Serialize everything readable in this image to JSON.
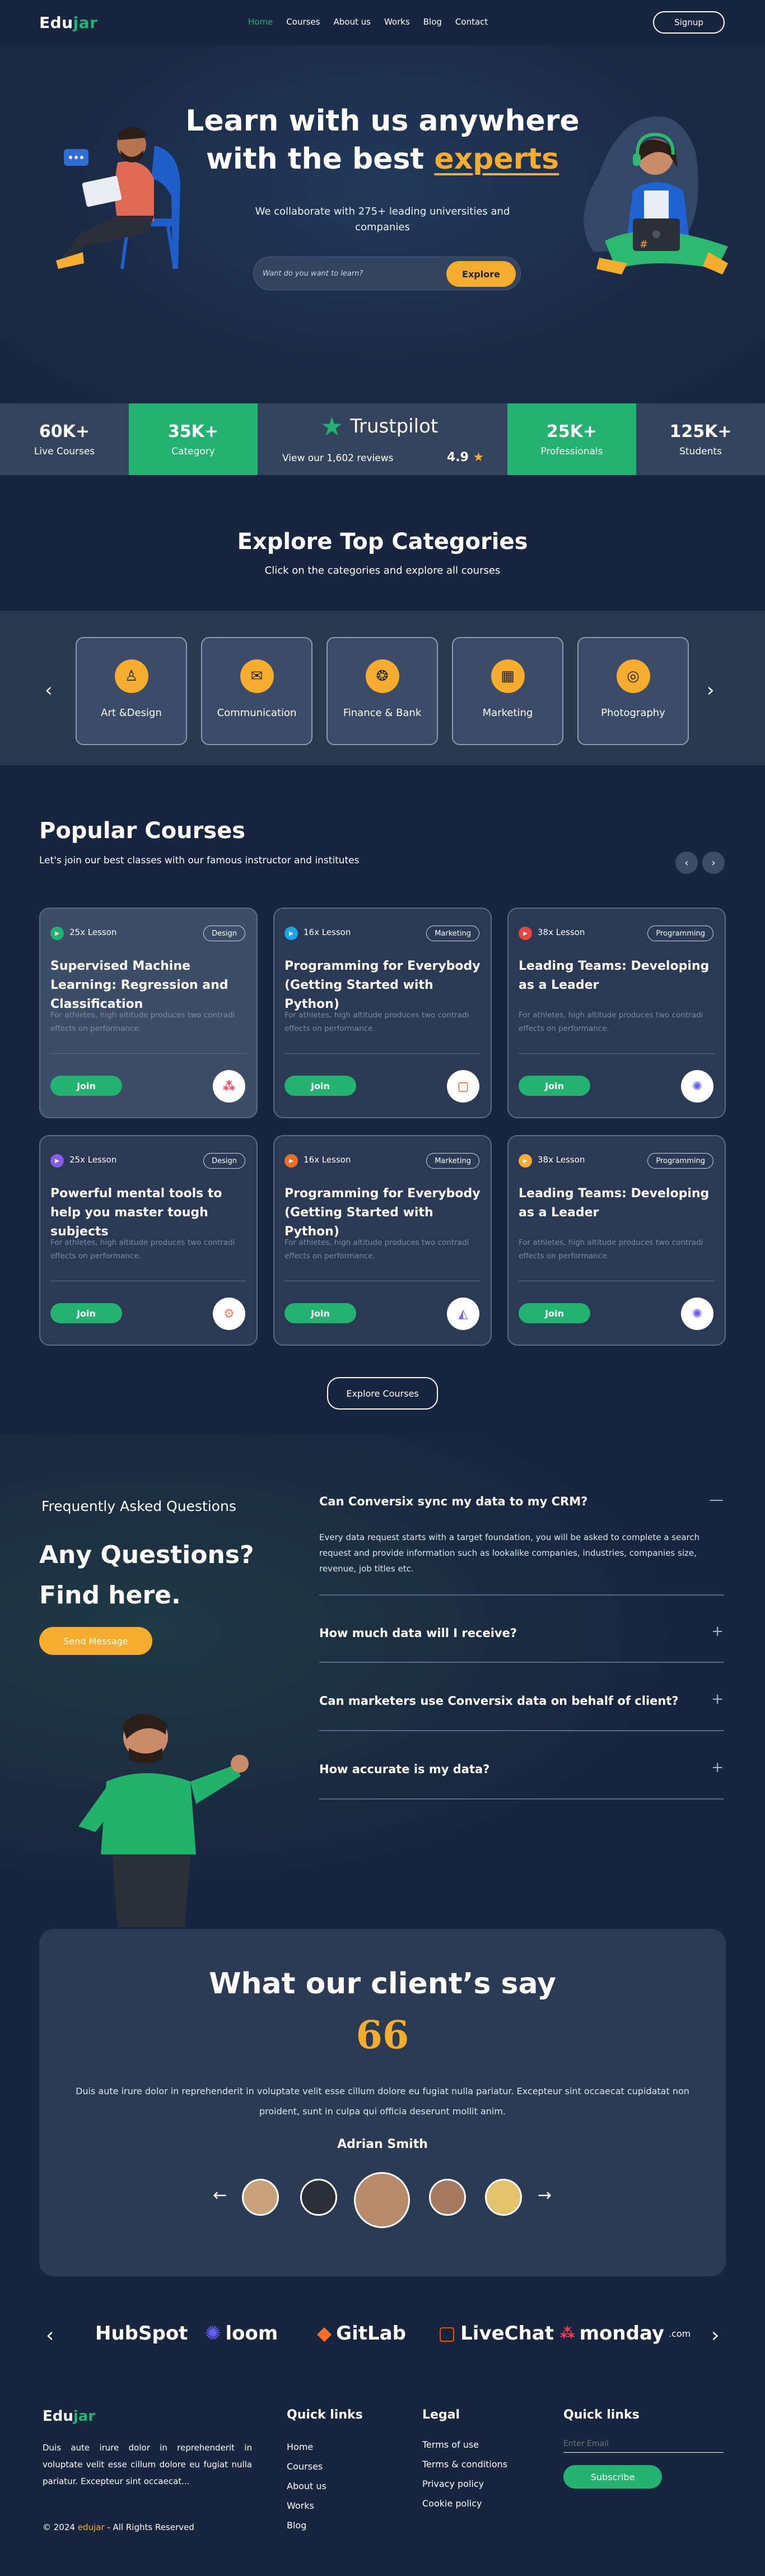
{
  "nav": {
    "logo_prefix": "Edu",
    "logo_suffix": "jar",
    "items": [
      "Home",
      "Courses",
      "About us",
      "Works",
      "Blog",
      "Contact"
    ],
    "signup": "Signup"
  },
  "hero": {
    "line1": "Learn with us anywhere",
    "line2_prefix": "with the best",
    "line2_highlight": "experts",
    "subtitle": "We collaborate with 275+ leading universities and companies",
    "search_placeholder": "Want do you want to learn?",
    "explore": "Explore"
  },
  "stats": [
    {
      "value": "60K+",
      "label": "Live Courses"
    },
    {
      "value": "35K+",
      "label": "Category"
    },
    {
      "value": "25K+",
      "label": "Professionals"
    },
    {
      "value": "125K+",
      "label": "Students"
    }
  ],
  "trustpilot": {
    "brand": "Trustpilot",
    "reviews": "View our 1,602 reviews",
    "score": "4.9"
  },
  "categories": {
    "title": "Explore Top Categories",
    "subtitle": "Click on the categories and explore all courses",
    "items": [
      {
        "label": "Art &Design",
        "icon": "art-icon"
      },
      {
        "label": "Communication",
        "icon": "chat-icon"
      },
      {
        "label": "Finance & Bank",
        "icon": "coins-icon"
      },
      {
        "label": "Marketing",
        "icon": "chart-icon"
      },
      {
        "label": "Photography",
        "icon": "camera-icon"
      }
    ]
  },
  "popular": {
    "title": "Popular Courses",
    "subtitle": "Let's join our best classes with our famous  instructor and institutes",
    "join": "Join",
    "explore": "Explore Courses",
    "courses": [
      {
        "lesson": "25x Lesson",
        "tag": "Design",
        "title": "Supervised Machine Learning: Regression and Classification",
        "desc": "For athletes, high altitude produces two contradi effects on performance.",
        "dot": "#24b270",
        "brand": "monday-icon"
      },
      {
        "lesson": "16x Lesson",
        "tag": "Marketing",
        "title": "Programming for Everybody (Getting Started with Python)",
        "desc": "For athletes, high altitude produces two contradi effects on performance.",
        "dot": "#1aa7e8",
        "brand": "livechat-icon"
      },
      {
        "lesson": "38x Lesson",
        "tag": "Programming",
        "title": "Leading Teams: Developing as a Leader",
        "desc": "For athletes, high altitude produces two contradi effects on performance.",
        "dot": "#e8473f",
        "brand": "loom-icon"
      },
      {
        "lesson": "25x Lesson",
        "tag": "Design",
        "title": "Powerful mental tools to help you master tough subjects",
        "desc": "For athletes, high altitude produces two contradi effects on performance.",
        "dot": "#8a5be8",
        "brand": "hubspot-icon"
      },
      {
        "lesson": "16x Lesson",
        "tag": "Marketing",
        "title": "Programming for Everybody (Getting Started with Python)",
        "desc": "For athletes, high altitude produces two contradi effects on performance.",
        "dot": "#f26b21",
        "brand": "clickup-icon"
      },
      {
        "lesson": "38x Lesson",
        "tag": "Programming",
        "title": "Leading Teams: Developing as a Leader",
        "desc": "For athletes, high altitude produces two contradi effects on performance.",
        "dot": "#f6ac2c",
        "brand": "loom-icon"
      }
    ]
  },
  "faq": {
    "kicker": "Frequently Asked Questions",
    "title1": "Any Questions?",
    "title2": "Find here.",
    "button": "Send Message",
    "items": [
      {
        "q": "Can Conversix sync my data to my CRM?",
        "a": "Every data request starts with a target foundation, you will be asked to complete a search request and provide information such as lookalike companies, industries, companies size, revenue, job titles etc.",
        "sign": "—"
      },
      {
        "q": "How much data will I receive?",
        "sign": "+"
      },
      {
        "q": "Can marketers use Conversix data on behalf of client?",
        "sign": "+"
      },
      {
        "q": "How accurate is my data?",
        "sign": "+"
      }
    ]
  },
  "testimonial": {
    "title": "What our client’s say",
    "quote_mark": "66",
    "text": "Duis aute irure dolor in reprehenderit in voluptate velit esse cillum dolore eu fugiat nulla pariatur. Excepteur sint occaecat cupidatat non proident, sunt in culpa qui officia deserunt mollit anim.",
    "name": "Adrian Smith"
  },
  "brands": [
    "HubSpot",
    "loom",
    "GitLab",
    "LiveChat",
    "monday",
    ".com"
  ],
  "footer": {
    "logo_prefix": "Edu",
    "logo_suffix": "jar",
    "about": "Duis aute irure dolor in reprehenderit in voluptate velit esse cillum dolore eu fugiat nulla pariatur. Excepteur sint occaecat...",
    "copyright_prefix": "© 2024",
    "copyright_brand": "edujar",
    "copyright_suffix": "- All Rights Reserved",
    "quick_title": "Quick links",
    "quick": [
      "Home",
      "Courses",
      "About us",
      "Works",
      "Blog"
    ],
    "legal_title": "Legal",
    "legal": [
      "Terms of use",
      "Terms & conditions",
      "Privacy policy",
      "Cookie policy"
    ],
    "sub_title": "Quick links",
    "email_placeholder": "Enter Email",
    "subscribe": "Subscribe"
  }
}
